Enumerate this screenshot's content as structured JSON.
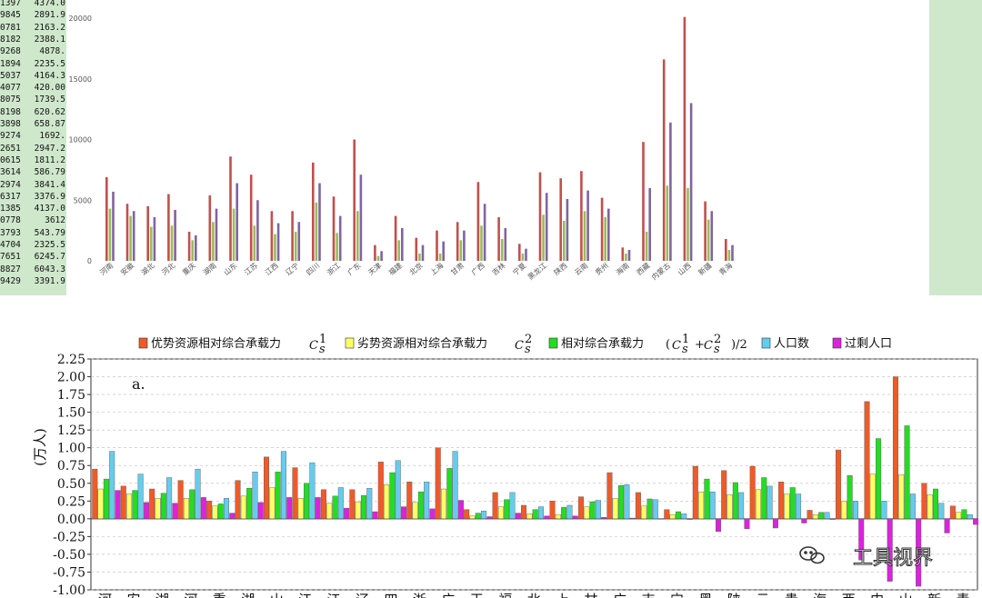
{
  "left_column": [
    [
      "1397",
      "4374.0"
    ],
    [
      "9845",
      "2891.9"
    ],
    [
      "0781",
      "2163.2"
    ],
    [
      "8182",
      "2388.1"
    ],
    [
      "9268",
      "4878."
    ],
    [
      "1894",
      "2235.5"
    ],
    [
      "5037",
      "4164.3"
    ],
    [
      "4077",
      "420.00"
    ],
    [
      "8075",
      "1739.5"
    ],
    [
      "8198",
      "620.62"
    ],
    [
      "3898",
      "658.87"
    ],
    [
      "9274",
      "1692."
    ],
    [
      "2651",
      "2947.2"
    ],
    [
      "0615",
      "1811.2"
    ],
    [
      "3614",
      "586.79"
    ],
    [
      "2974",
      "3841.4"
    ],
    [
      "6317",
      "3376.9"
    ],
    [
      "1385",
      "4137.0"
    ],
    [
      "0778",
      "3612"
    ],
    [
      "3793",
      "543.79"
    ],
    [
      "4704",
      "2325.5"
    ],
    [
      "7651",
      "6245.7"
    ],
    [
      "8827",
      "6043.3"
    ],
    [
      "9429",
      "3391.9"
    ]
  ],
  "chart_data": [
    {
      "type": "bar",
      "title": "",
      "xlabel": "",
      "ylabel": "",
      "ylim": [
        0,
        22000
      ],
      "yticks": [
        0,
        5000,
        10000,
        15000,
        20000
      ],
      "grid": false,
      "colors": [
        "#c0504d",
        "#9bbb59",
        "#8064a2"
      ],
      "categories": [
        "河南",
        "安徽",
        "湖北",
        "河北",
        "重庆",
        "湖南",
        "山东",
        "江苏",
        "江西",
        "辽宁",
        "四川",
        "浙江",
        "广东",
        "天津",
        "福建",
        "北京",
        "上海",
        "甘肃",
        "广西",
        "吉林",
        "宁夏",
        "黑龙江",
        "陕西",
        "云南",
        "贵州",
        "海南",
        "西藏",
        "内蒙古",
        "山西",
        "新疆",
        "青海"
      ],
      "series": [
        {
          "values": [
            6900,
            4700,
            4500,
            5500,
            2400,
            5400,
            8600,
            7100,
            4100,
            4100,
            8100,
            5300,
            10000,
            1300,
            3700,
            1900,
            2500,
            3200,
            6500,
            3600,
            1400,
            7300,
            6800,
            7400,
            5200,
            1100,
            9800,
            16600,
            20100,
            4900,
            1800
          ]
        },
        {
          "values": [
            4300,
            3700,
            2800,
            2900,
            1700,
            3200,
            4300,
            2900,
            2200,
            2400,
            4800,
            2300,
            4100,
            400,
            1700,
            600,
            600,
            1700,
            2900,
            1800,
            600,
            3800,
            3300,
            4100,
            3600,
            600,
            2400,
            6200,
            6000,
            3400,
            900
          ]
        },
        {
          "values": [
            5700,
            4100,
            3600,
            4200,
            2100,
            4300,
            6400,
            5000,
            3100,
            3200,
            6400,
            3700,
            7100,
            800,
            2700,
            1300,
            1600,
            2500,
            4700,
            2700,
            1000,
            5600,
            5100,
            5800,
            4300,
            900,
            6000,
            11400,
            13000,
            4100,
            1300
          ]
        }
      ]
    },
    {
      "type": "bar",
      "title": "",
      "xlabel": "",
      "ylabel": "(万人)",
      "panel_label": "a.",
      "ylim": [
        -1.0,
        2.25
      ],
      "yticks": [
        "-1.00",
        "-0.75",
        "-0.50",
        "-0.25",
        "0.00",
        "0.25",
        "0.50",
        "0.75",
        "1.00",
        "1.25",
        "1.50",
        "1.75",
        "2.00",
        "2.25"
      ],
      "grid": true,
      "categories": [
        "河",
        "安",
        "湖",
        "河",
        "重",
        "湖",
        "山",
        "江",
        "江",
        "辽",
        "四",
        "浙",
        "广",
        "天",
        "福",
        "北",
        "上",
        "甘",
        "广",
        "吉",
        "宁",
        "黑",
        "陕",
        "云",
        "贵",
        "海",
        "西",
        "内",
        "山",
        "新",
        "青"
      ],
      "legend": [
        "优势资源相对综合承载力",
        "劣势资源相对综合承载力",
        "相对综合承载力",
        "人口数",
        "过剩人口"
      ],
      "legend_math": {
        "c1": "C",
        "c1_sub": "s",
        "c1_sup": "1",
        "c2_sup": "2",
        "c3_open": "(",
        "c3_plus": "+",
        "c3_close": ")/2"
      },
      "colors": [
        "#f05a28",
        "#ffff66",
        "#22dd22",
        "#66ccee",
        "#dd22dd"
      ],
      "series": [
        {
          "values": [
            0.7,
            0.46,
            0.42,
            0.54,
            0.25,
            0.54,
            0.87,
            0.72,
            0.41,
            0.41,
            0.8,
            0.52,
            1.0,
            0.13,
            0.37,
            0.19,
            0.25,
            0.31,
            0.65,
            0.37,
            0.13,
            0.74,
            0.68,
            0.74,
            0.52,
            0.12,
            0.97,
            1.65,
            2.0,
            0.5,
            0.18
          ]
        },
        {
          "values": [
            0.42,
            0.35,
            0.29,
            0.29,
            0.18,
            0.32,
            0.44,
            0.29,
            0.22,
            0.24,
            0.48,
            0.23,
            0.42,
            0.04,
            0.17,
            0.07,
            0.06,
            0.17,
            0.29,
            0.18,
            0.06,
            0.38,
            0.34,
            0.41,
            0.35,
            0.06,
            0.25,
            0.63,
            0.62,
            0.34,
            0.09
          ]
        },
        {
          "values": [
            0.56,
            0.4,
            0.36,
            0.41,
            0.21,
            0.43,
            0.66,
            0.5,
            0.32,
            0.33,
            0.65,
            0.38,
            0.71,
            0.08,
            0.27,
            0.13,
            0.16,
            0.24,
            0.47,
            0.28,
            0.1,
            0.56,
            0.51,
            0.58,
            0.44,
            0.09,
            0.61,
            1.13,
            1.31,
            0.42,
            0.13
          ]
        },
        {
          "values": [
            0.95,
            0.63,
            0.58,
            0.7,
            0.29,
            0.66,
            0.95,
            0.79,
            0.44,
            0.43,
            0.82,
            0.52,
            0.95,
            0.11,
            0.37,
            0.17,
            0.19,
            0.26,
            0.48,
            0.27,
            0.07,
            0.38,
            0.37,
            0.46,
            0.35,
            0.09,
            0.25,
            0.25,
            0.35,
            0.22,
            0.06
          ]
        },
        {
          "values": [
            0.4,
            0.23,
            0.22,
            0.3,
            0.08,
            0.23,
            0.3,
            0.3,
            0.15,
            0.1,
            0.17,
            0.14,
            0.26,
            0.03,
            0.08,
            0.04,
            0.04,
            0.02,
            0.01,
            0.0,
            -0.01,
            -0.18,
            -0.14,
            -0.13,
            -0.06,
            -0.01,
            -0.58,
            -0.88,
            -0.95,
            -0.2,
            -0.08
          ]
        }
      ]
    }
  ],
  "watermark": {
    "text": "工具视界",
    "icon": "wechat-icon"
  }
}
